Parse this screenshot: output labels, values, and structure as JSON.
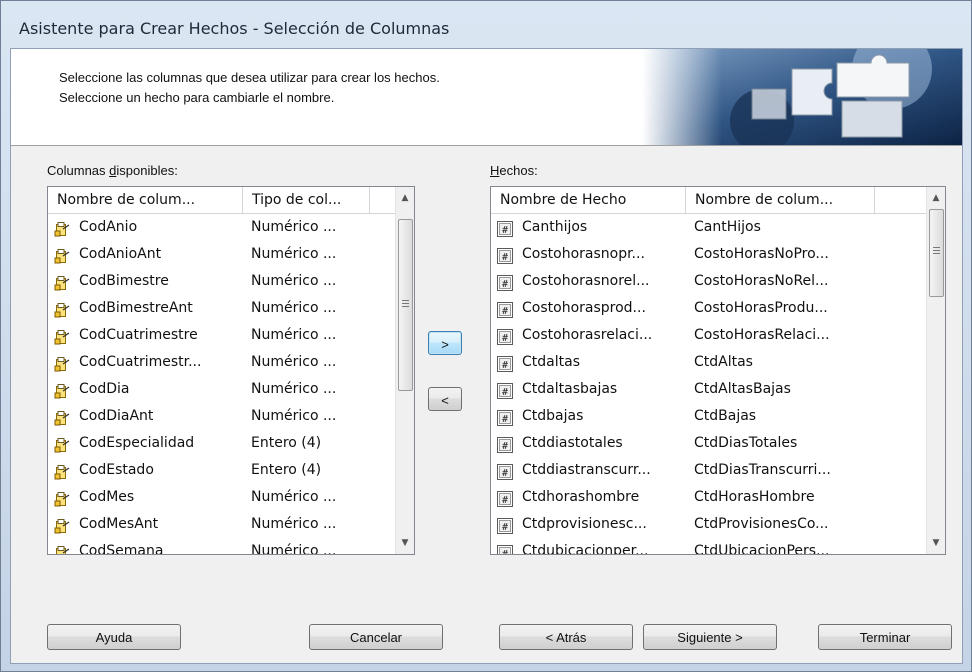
{
  "window": {
    "title": "Asistente para Crear Hechos - Selección de Columnas"
  },
  "header": {
    "line1": "Seleccione las columnas que desea utilizar para crear los hechos.",
    "line2": "Seleccione un hecho para cambiarle el nombre."
  },
  "available": {
    "label_pre": "Columnas ",
    "label_u": "d",
    "label_post": "isponibles:",
    "col1": "Nombre de colum...",
    "col2": "Tipo de col...",
    "icon": "key-column-icon",
    "rows": [
      {
        "name": "CodAnio",
        "type": "Numérico ..."
      },
      {
        "name": "CodAnioAnt",
        "type": "Numérico ..."
      },
      {
        "name": "CodBimestre",
        "type": "Numérico ..."
      },
      {
        "name": "CodBimestreAnt",
        "type": "Numérico ..."
      },
      {
        "name": "CodCuatrimestre",
        "type": "Numérico ..."
      },
      {
        "name": "CodCuatrimestr...",
        "type": "Numérico ..."
      },
      {
        "name": "CodDia",
        "type": "Numérico ..."
      },
      {
        "name": "CodDiaAnt",
        "type": "Numérico ..."
      },
      {
        "name": "CodEspecialidad",
        "type": "Entero (4)"
      },
      {
        "name": "CodEstado",
        "type": "Entero (4)"
      },
      {
        "name": "CodMes",
        "type": "Numérico ..."
      },
      {
        "name": "CodMesAnt",
        "type": "Numérico ..."
      },
      {
        "name": "CodSemana",
        "type": "Numérico ..."
      }
    ]
  },
  "facts": {
    "label_u": "H",
    "label_post": "echos:",
    "col1": "Nombre de Hecho",
    "col2": "Nombre de colum...",
    "icon": "numeric-fact-icon",
    "rows": [
      {
        "name": "Canthijos",
        "col": "CantHijos"
      },
      {
        "name": "Costohorasnopr...",
        "col": "CostoHorasNoPro..."
      },
      {
        "name": "Costohorasnorel...",
        "col": "CostoHorasNoRel..."
      },
      {
        "name": "Costohorasprod...",
        "col": "CostoHorasProdu..."
      },
      {
        "name": "Costohorasrelaci...",
        "col": "CostoHorasRelaci..."
      },
      {
        "name": "Ctdaltas",
        "col": "CtdAltas"
      },
      {
        "name": "Ctdaltasbajas",
        "col": "CtdAltasBajas"
      },
      {
        "name": "Ctdbajas",
        "col": "CtdBajas"
      },
      {
        "name": "Ctddiastotales",
        "col": "CtdDiasTotales"
      },
      {
        "name": "Ctddiastranscurr...",
        "col": "CtdDiasTranscurri..."
      },
      {
        "name": "Ctdhorashombre",
        "col": "CtdHorasHombre"
      },
      {
        "name": "Ctdprovisionesc...",
        "col": "CtdProvisionesCo..."
      },
      {
        "name": "Ctdubicacionper...",
        "col": "CtdUbicacionPers..."
      }
    ]
  },
  "buttons": {
    "add": ">",
    "remove": "<",
    "help": "Ayuda",
    "cancel": "Cancelar",
    "back": "< Atrás",
    "next": "Siguiente >",
    "finish": "Terminar"
  }
}
